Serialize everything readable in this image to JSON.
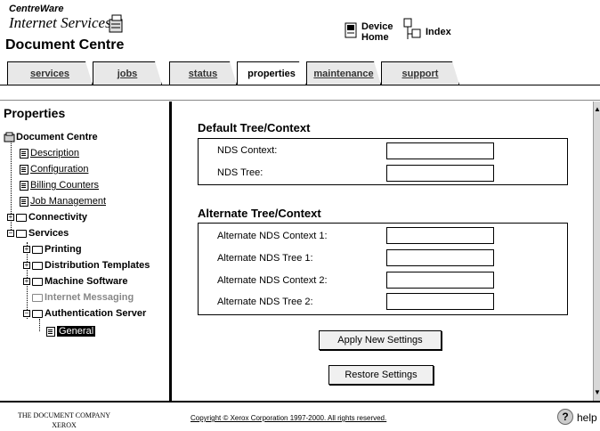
{
  "header": {
    "brand_line1": "CentreWare",
    "brand_line2": "Internet Services",
    "app_title": "Document Centre",
    "device_home_line1": "Device",
    "device_home_line2": "Home",
    "index_label": "Index"
  },
  "tabs": [
    {
      "label": "services"
    },
    {
      "label": "jobs"
    },
    {
      "label": "status"
    },
    {
      "label": "properties",
      "active": true
    },
    {
      "label": "maintenance"
    },
    {
      "label": "support"
    }
  ],
  "sidebar": {
    "title": "Properties",
    "root": "Document Centre",
    "items": [
      {
        "label": "Description"
      },
      {
        "label": "Configuration"
      },
      {
        "label": "Billing Counters"
      },
      {
        "label": "Job Management"
      },
      {
        "label": "Connectivity"
      },
      {
        "label": "Services"
      },
      {
        "label": "Printing"
      },
      {
        "label": "Distribution Templates"
      },
      {
        "label": "Machine Software"
      },
      {
        "label": "Internet Messaging"
      },
      {
        "label": "Authentication Server"
      },
      {
        "label": "General"
      }
    ]
  },
  "main": {
    "default_section": {
      "title": "Default Tree/Context",
      "fields": [
        {
          "label": "NDS Context:",
          "value": ""
        },
        {
          "label": "NDS Tree:",
          "value": ""
        }
      ]
    },
    "alternate_section": {
      "title": "Alternate Tree/Context",
      "fields": [
        {
          "label": "Alternate NDS Context 1:",
          "value": ""
        },
        {
          "label": "Alternate NDS Tree 1:",
          "value": ""
        },
        {
          "label": "Alternate NDS Context 2:",
          "value": ""
        },
        {
          "label": "Alternate NDS Tree 2:",
          "value": ""
        }
      ]
    },
    "apply_button": "Apply New Settings",
    "restore_button": "Restore Settings"
  },
  "footer": {
    "company_line1": "The Document Company",
    "company_line2": "XEROX",
    "copyright": "Copyright © Xerox Corporation 1997-2000. All rights reserved.",
    "help_label": "help"
  }
}
